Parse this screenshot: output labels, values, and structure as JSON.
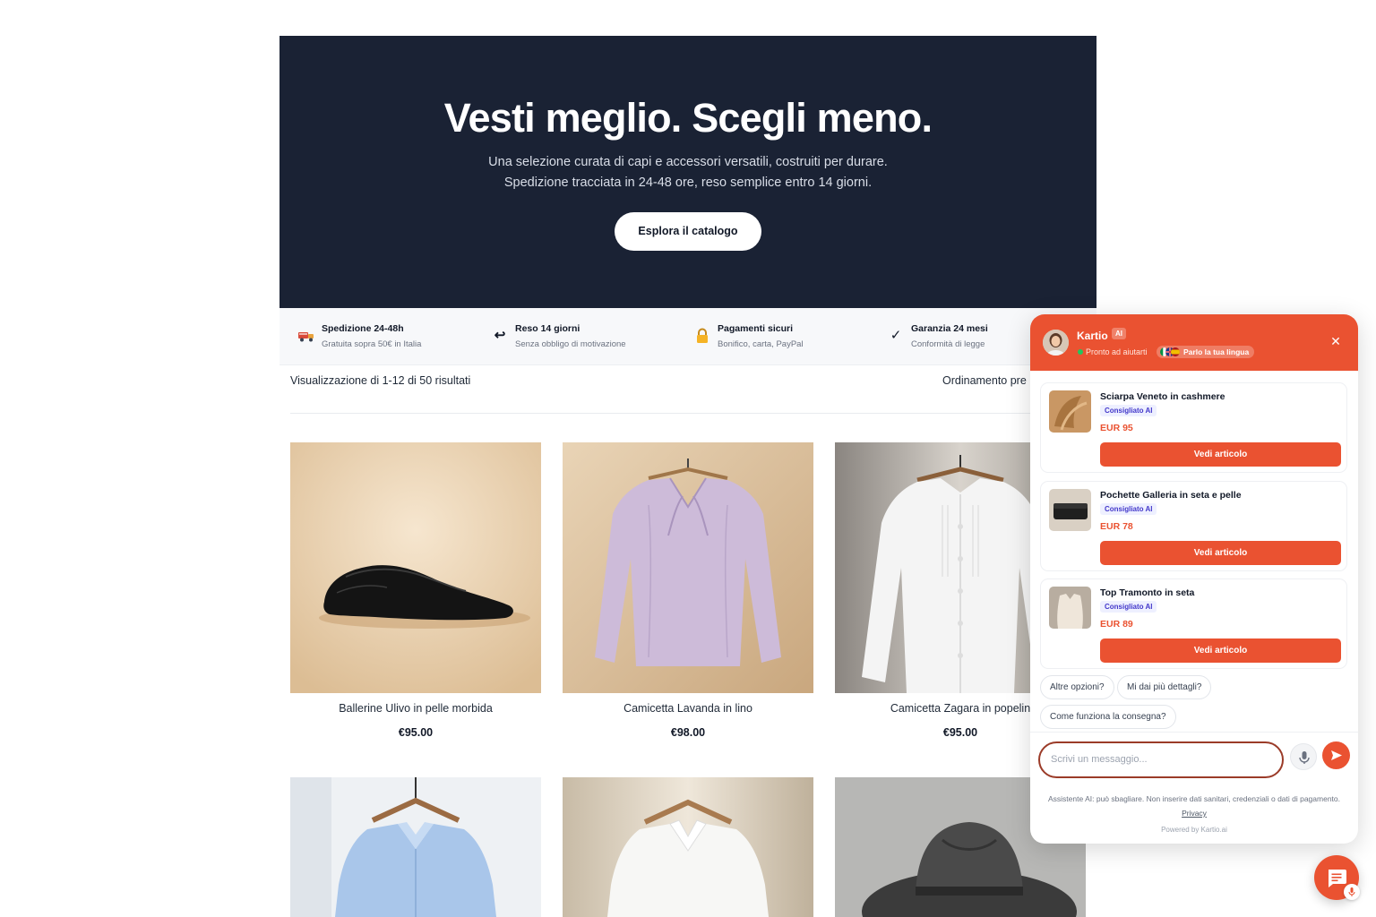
{
  "hero": {
    "title": "Vesti meglio. Scegli meno.",
    "subtitle_line1": "Una selezione curata di capi e accessori versatili, costruiti per durare.",
    "subtitle_line2": "Spedizione tracciata in 24-48 ore, reso semplice entro 14 giorni.",
    "cta_label": "Esplora il catalogo"
  },
  "features": [
    {
      "icon": "truck-icon",
      "title": "Spedizione 24-48h",
      "subtitle": "Gratuita sopra 50€ in Italia"
    },
    {
      "icon": "return-arrow-icon",
      "title": "Reso 14 giorni",
      "subtitle": "Senza obbligo di motivazione"
    },
    {
      "icon": "lock-icon",
      "title": "Pagamenti sicuri",
      "subtitle": "Bonifico, carta, PayPal"
    },
    {
      "icon": "checkmark-icon",
      "title": "Garanzia 24 mesi",
      "subtitle": "Conformità di legge"
    }
  ],
  "catalog": {
    "results_count": "Visualizzazione di 1-12 di 50 risultati",
    "sort_label": "Ordinamento pre"
  },
  "products": [
    {
      "name": "Ballerine Ulivo in pelle morbida",
      "price": "€95.00"
    },
    {
      "name": "Camicetta Lavanda in lino",
      "price": "€98.00"
    },
    {
      "name": "Camicetta Zagara in popelin",
      "price": "€95.00"
    },
    {
      "name": "",
      "price": ""
    },
    {
      "name": "",
      "price": ""
    },
    {
      "name": "",
      "price": ""
    }
  ],
  "chat": {
    "agent_name": "Kartio",
    "ai_badge": "AI",
    "status": "Pronto ad aiutarti",
    "language_pill": "Parlo la tua lingua",
    "recommendations": [
      {
        "title": "Sciarpa Veneto in cashmere",
        "badge": "Consigliato AI",
        "price": "EUR 95",
        "button": "Vedi articolo"
      },
      {
        "title": "Pochette Galleria in seta e pelle",
        "badge": "Consigliato AI",
        "price": "EUR 78",
        "button": "Vedi articolo"
      },
      {
        "title": "Top Tramonto in seta",
        "badge": "Consigliato AI",
        "price": "EUR 89",
        "button": "Vedi articolo"
      }
    ],
    "quick_replies": [
      "Altre opzioni?",
      "Mi dai più dettagli?",
      "Come funziona la consegna?"
    ],
    "input_placeholder": "Scrivi un messaggio...",
    "disclaimer": "Assistente AI: può sbagliare. Non inserire dati sanitari, credenziali o dati di pagamento.",
    "privacy_link": "Privacy",
    "powered_by": "Powered by Kartio.ai"
  },
  "colors": {
    "brand": "#ea5231",
    "hero_bg": "#1a2234",
    "ai_badge_text": "#4338ca"
  }
}
